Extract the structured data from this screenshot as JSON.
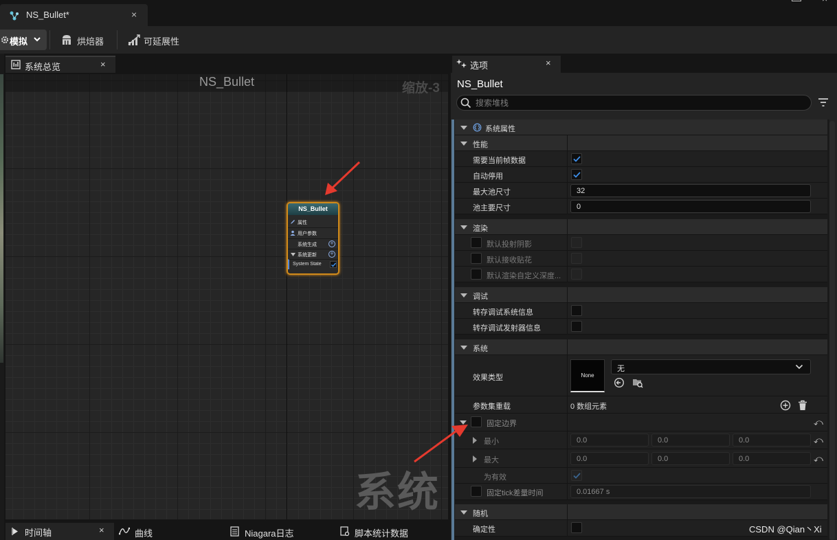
{
  "window": {
    "doc_tab": "NS_Bullet*",
    "close": "×"
  },
  "toolbar": {
    "simulate": "模拟",
    "baker": "烘焙器",
    "scalability": "可延展性"
  },
  "overview": {
    "tab_label": "系统总览",
    "close": "×",
    "graph_title": "NS_Bullet",
    "zoom": "缩放-3",
    "watermark": "系统",
    "node": {
      "title": "NS_Bullet",
      "rows": [
        "属性",
        "用户参数",
        "系统生成",
        "系统更新",
        "System State"
      ]
    }
  },
  "bottom_tabs": {
    "timeline": "时间轴",
    "close": "×",
    "curves": "曲线",
    "log": "Niagara日志",
    "stats": "脚本统计数据"
  },
  "panel": {
    "tab_label": "选项",
    "close": "×",
    "title": "NS_Bullet",
    "search_placeholder": "搜索堆栈",
    "system_properties": "系统属性",
    "performance": {
      "header": "性能",
      "require_frame_data": "需要当前帧数据",
      "require_frame_data_value": true,
      "auto_deactivate": "自动停用",
      "auto_deactivate_value": true,
      "max_pool_size": "最大池尺寸",
      "max_pool_size_value": "32",
      "pool_prime_size": "池主要尺寸",
      "pool_prime_size_value": "0"
    },
    "rendering": {
      "header": "渲染",
      "cast_shadow": "默认投射阴影",
      "receive_decals": "默认接收贴花",
      "render_custom_depth": "默认渲染自定义深度..."
    },
    "debug": {
      "header": "调试",
      "dump_system_info": "转存调试系统信息",
      "dump_emitter_info": "转存调试发射器信息"
    },
    "system": {
      "header": "系统",
      "effect_type": "效果类型",
      "effect_thumb": "None",
      "effect_value": "无",
      "param_overrides": "参数集重载",
      "param_overrides_value": "0 数组元素",
      "fixed_bounds": "固定边界",
      "min": "最小",
      "max": "最大",
      "min_values": [
        "0.0",
        "0.0",
        "0.0"
      ],
      "max_values": [
        "0.0",
        "0.0",
        "0.0"
      ],
      "is_valid": "为有效",
      "fixed_tick": "固定tick差量时间",
      "fixed_tick_value": "0.01667 s"
    },
    "random": {
      "header": "随机",
      "determinism": "确定性"
    }
  },
  "credit": "CSDN @Qian丶Xi",
  "colors": {
    "accent": "#d08a1a",
    "check_blue": "#3d8ee8",
    "background": "#242424"
  }
}
